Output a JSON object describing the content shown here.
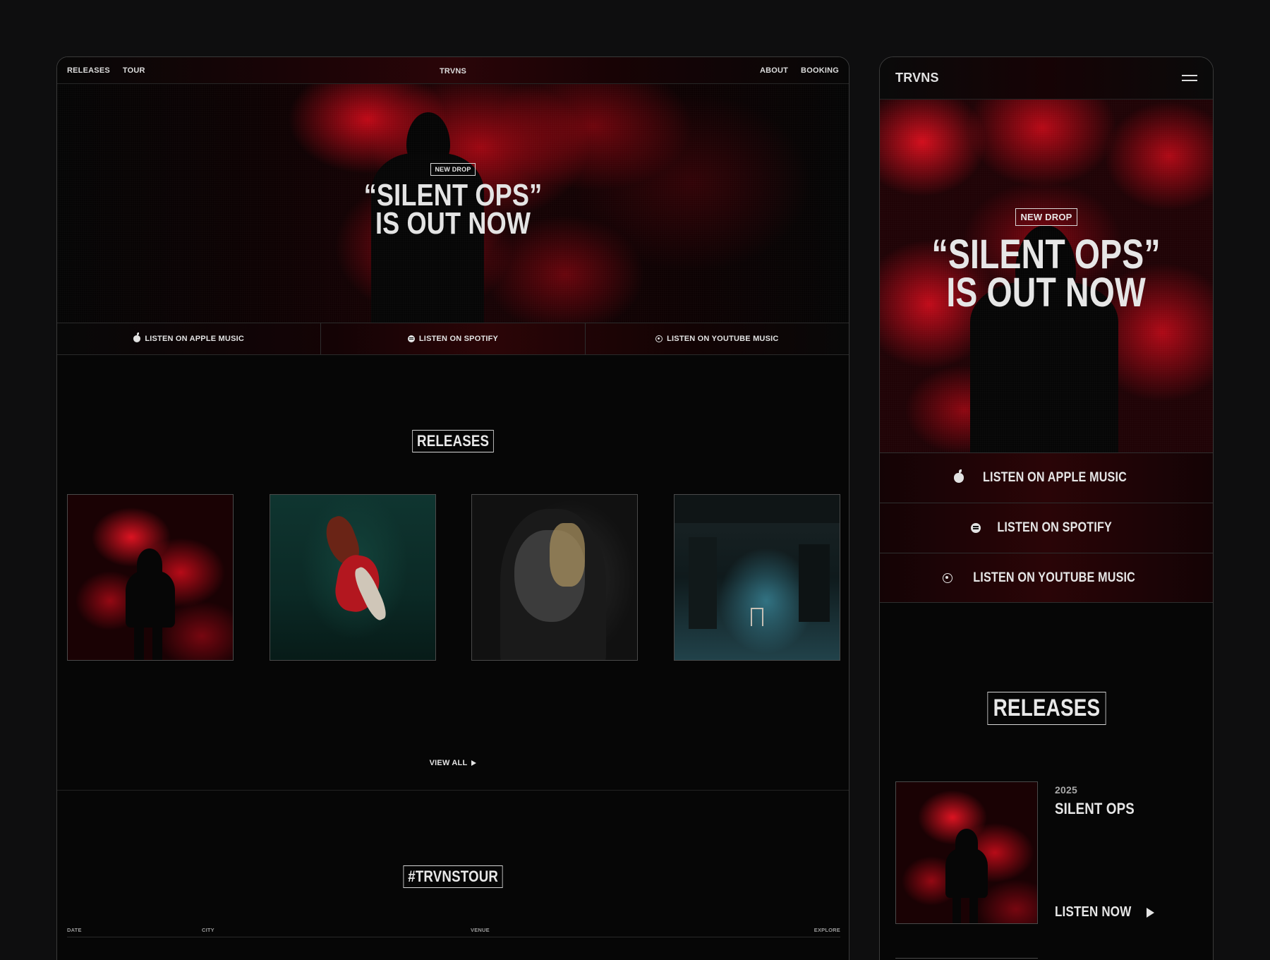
{
  "desktop": {
    "nav": {
      "releases": "RELEASES",
      "tour": "TOUR",
      "logo": "TRVNS",
      "about": "ABOUT",
      "booking": "BOOKING"
    },
    "hero": {
      "badge": "NEW DROP",
      "title_line1": "“SILENT OPS”",
      "title_line2": "IS OUT NOW"
    },
    "listen": [
      {
        "label": "LISTEN ON APPLE MUSIC",
        "icon": "apple-icon"
      },
      {
        "label": "LISTEN ON SPOTIFY",
        "icon": "spotify-icon"
      },
      {
        "label": "LISTEN ON YOUTUBE MUSIC",
        "icon": "youtube-music-icon"
      }
    ],
    "releases_title": "RELEASES",
    "view_all": "VIEW ALL",
    "tour_title": "#TRVNSTOUR",
    "table_headers": {
      "date": "DATE",
      "city": "CITY",
      "venue": "VENUE",
      "explore": "EXPLORE"
    }
  },
  "mobile": {
    "logo": "TRVNS",
    "hero": {
      "badge": "NEW DROP",
      "title_line1": "“SILENT OPS”",
      "title_line2": "IS OUT NOW"
    },
    "listen": [
      {
        "label": "LISTEN ON APPLE MUSIC",
        "icon": "apple-icon"
      },
      {
        "label": "LISTEN ON SPOTIFY",
        "icon": "spotify-icon"
      },
      {
        "label": "LISTEN ON YOUTUBE MUSIC",
        "icon": "youtube-music-icon"
      }
    ],
    "releases_title": "RELEASES",
    "release": {
      "year": "2025",
      "title": "SILENT OPS",
      "cta": "LISTEN NOW"
    }
  },
  "colors": {
    "background": "#0e0e0f",
    "accent_red": "#c8101e",
    "text": "#e6e6e6"
  }
}
